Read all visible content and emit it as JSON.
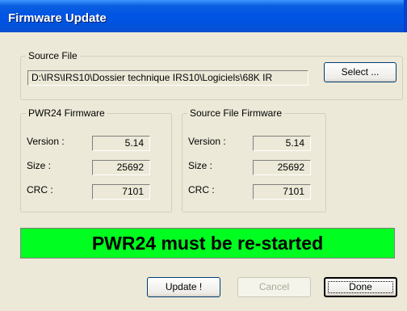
{
  "window": {
    "title": "Firmware Update"
  },
  "source_file": {
    "legend": "Source File",
    "path": "D:\\IRS\\IRS10\\Dossier technique IRS10\\Logiciels\\68K IR",
    "select_label": "Select ..."
  },
  "pwr24_firmware": {
    "legend": "PWR24 Firmware",
    "version_label": "Version :",
    "version": "5.14",
    "size_label": "Size :",
    "size": "25692",
    "crc_label": "CRC :",
    "crc": "7101"
  },
  "source_file_firmware": {
    "legend": "Source File Firmware",
    "version_label": "Version :",
    "version": "5.14",
    "size_label": "Size :",
    "size": "25692",
    "crc_label": "CRC :",
    "crc": "7101"
  },
  "status": {
    "message": "PWR24 must be re-started",
    "color": "#00FF20"
  },
  "buttons": {
    "update": "Update !",
    "cancel": "Cancel",
    "done": "Done"
  }
}
